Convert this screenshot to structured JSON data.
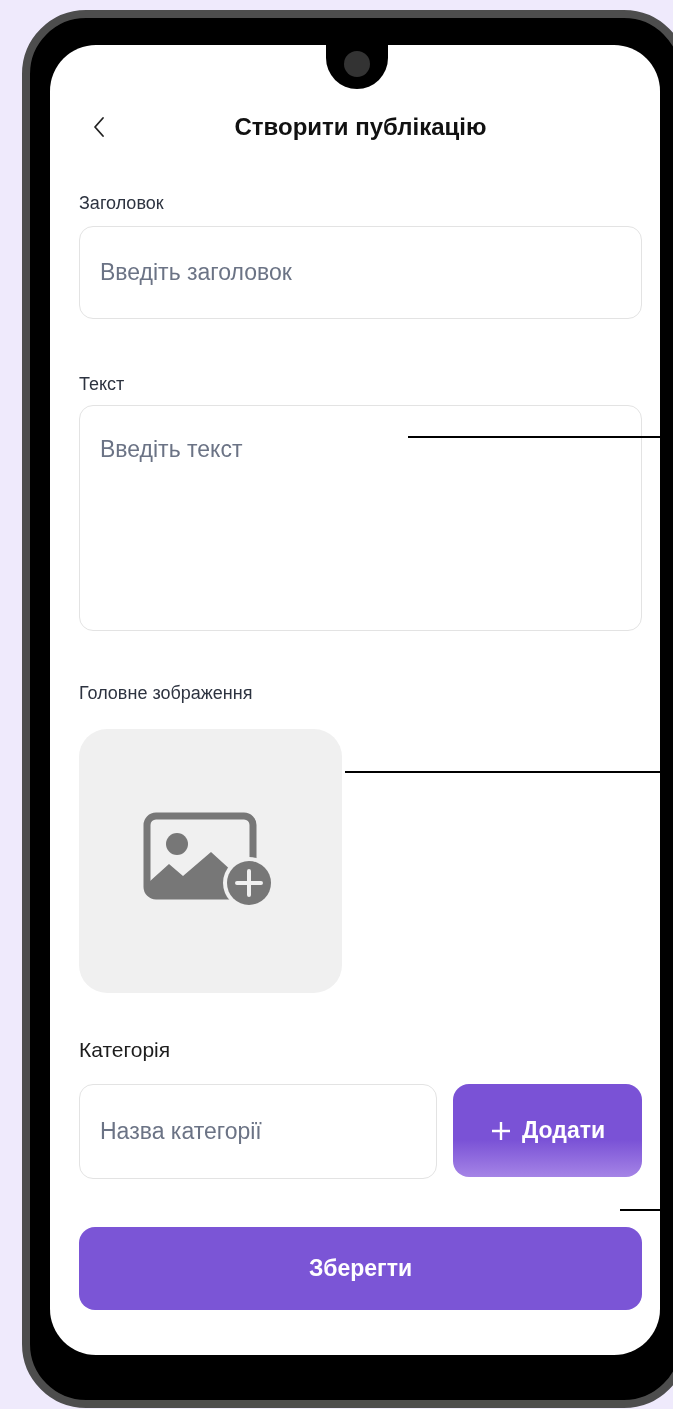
{
  "header": {
    "title": "Створити публікацію"
  },
  "fields": [
    {
      "label": "Заголовок",
      "placeholder": "Введіть заголовок",
      "kind": "input"
    },
    {
      "label": "Текст",
      "placeholder": "Введіть текст",
      "kind": "textarea"
    }
  ],
  "image_section": {
    "label": "Головне зображення"
  },
  "category": {
    "label": "Категорія",
    "placeholder": "Назва категорії",
    "add_button": "Додати"
  },
  "save_button": "Зберегти"
}
